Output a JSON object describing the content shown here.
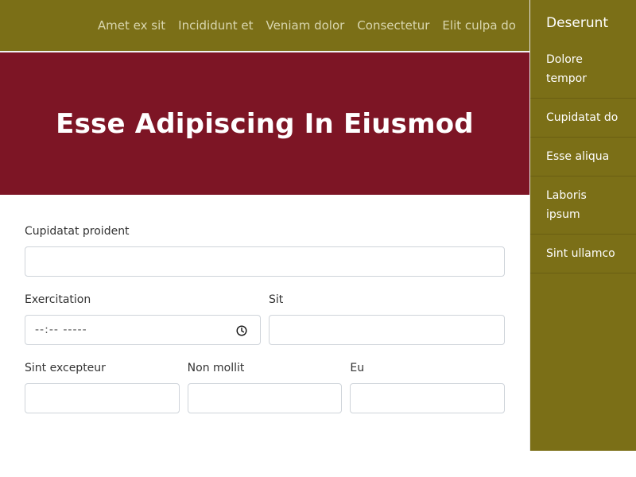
{
  "topnav": {
    "links": [
      "Amet ex sit",
      "Incididunt et",
      "Veniam dolor",
      "Consectetur",
      "Elit culpa do"
    ]
  },
  "hero": {
    "title": "Esse Adipiscing In Eiusmod"
  },
  "sidebar": {
    "title": "Deserunt",
    "items": [
      "Dolore tempor",
      "Cupidatat do",
      "Esse aliqua",
      "Laboris ipsum",
      "Sint ullamco"
    ]
  },
  "form": {
    "field1": {
      "label": "Cupidatat proident",
      "value": ""
    },
    "field2": {
      "label": "Exercitation",
      "placeholder": "--:-- -----"
    },
    "field3": {
      "label": "Sit",
      "value": ""
    },
    "field4": {
      "label": "Sint excepteur",
      "value": ""
    },
    "field5": {
      "label": "Non mollit",
      "value": ""
    },
    "field6": {
      "label": "Eu",
      "value": ""
    }
  },
  "colors": {
    "nav_bg": "#7b6f17",
    "hero_bg": "#7d1525",
    "nav_text": "#d9d6ae"
  },
  "icons": {
    "time_input": "clock-icon"
  }
}
